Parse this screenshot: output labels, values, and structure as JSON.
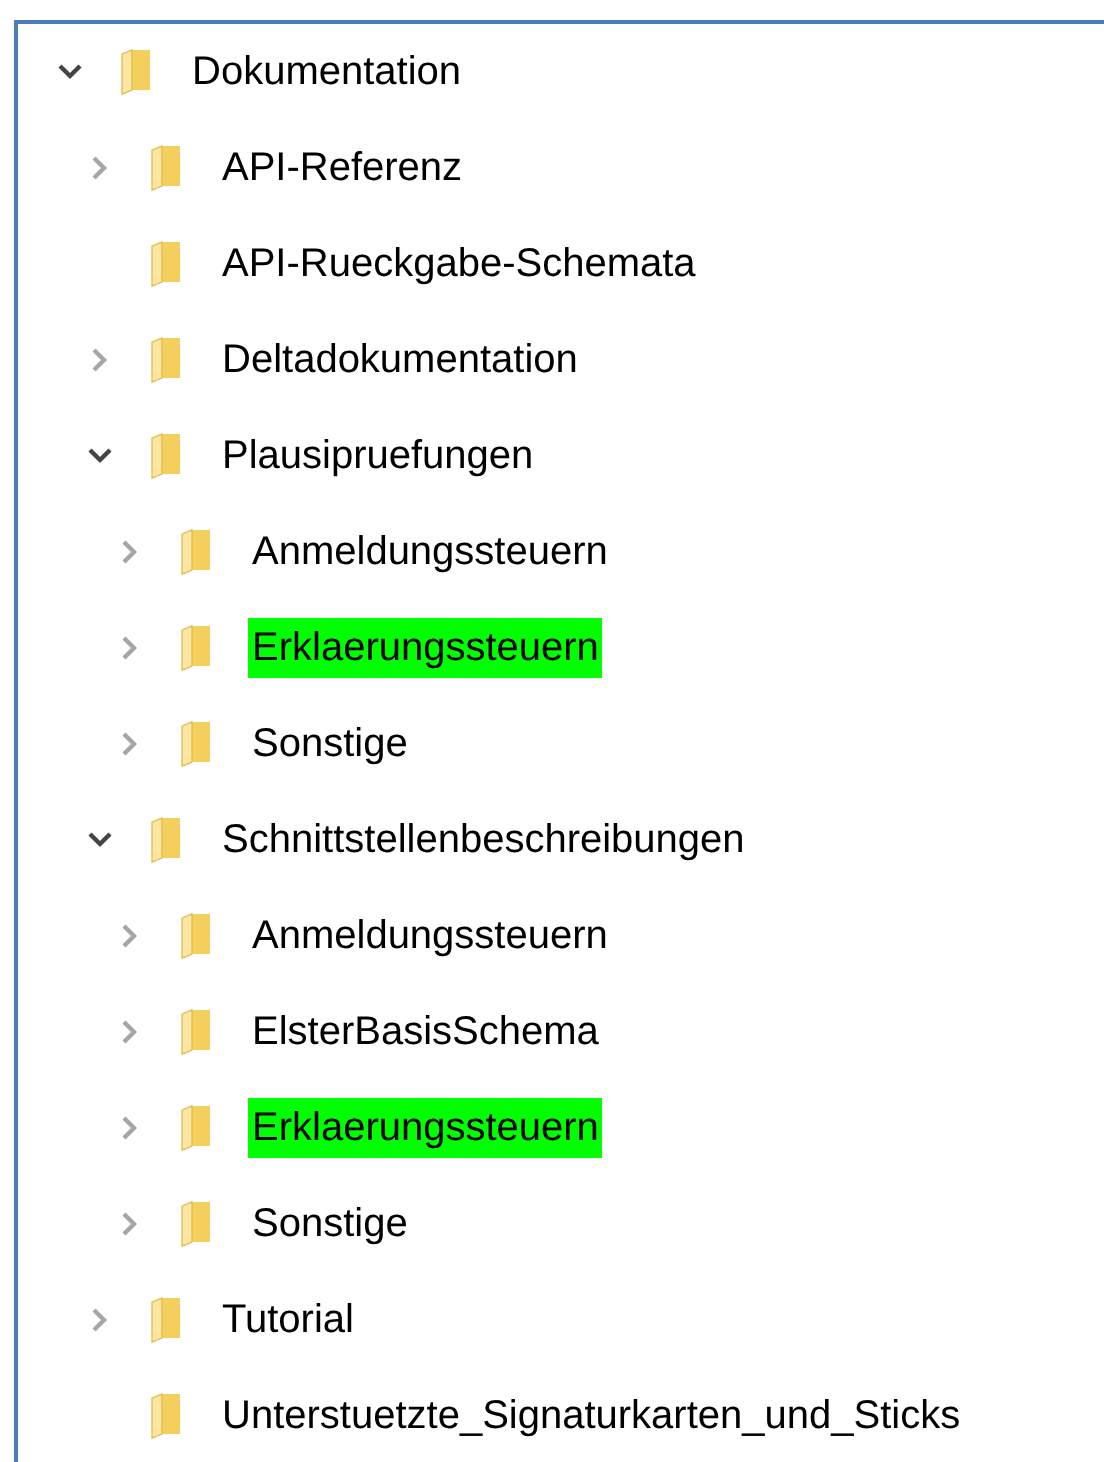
{
  "tree": [
    {
      "label": "Dokumentation",
      "kind": "branch",
      "expanded": true,
      "highlighted": false,
      "children": [
        {
          "label": "API-Referenz",
          "kind": "branch",
          "expanded": false,
          "highlighted": false
        },
        {
          "label": "API-Rueckgabe-Schemata",
          "kind": "leaf",
          "highlighted": false
        },
        {
          "label": "Deltadokumentation",
          "kind": "branch",
          "expanded": false,
          "highlighted": false
        },
        {
          "label": "Plausipruefungen",
          "kind": "branch",
          "expanded": true,
          "highlighted": false,
          "children": [
            {
              "label": "Anmeldungssteuern",
              "kind": "branch",
              "expanded": false,
              "highlighted": false
            },
            {
              "label": "Erklaerungssteuern",
              "kind": "branch",
              "expanded": false,
              "highlighted": true
            },
            {
              "label": "Sonstige",
              "kind": "branch",
              "expanded": false,
              "highlighted": false
            }
          ]
        },
        {
          "label": "Schnittstellenbeschreibungen",
          "kind": "branch",
          "expanded": true,
          "highlighted": false,
          "children": [
            {
              "label": "Anmeldungssteuern",
              "kind": "branch",
              "expanded": false,
              "highlighted": false
            },
            {
              "label": "ElsterBasisSchema",
              "kind": "branch",
              "expanded": false,
              "highlighted": false
            },
            {
              "label": "Erklaerungssteuern",
              "kind": "branch",
              "expanded": false,
              "highlighted": true
            },
            {
              "label": "Sonstige",
              "kind": "branch",
              "expanded": false,
              "highlighted": false
            }
          ]
        },
        {
          "label": "Tutorial",
          "kind": "branch",
          "expanded": false,
          "highlighted": false
        },
        {
          "label": "Unterstuetzte_Signaturkarten_und_Sticks",
          "kind": "leaf",
          "highlighted": false
        }
      ]
    }
  ]
}
